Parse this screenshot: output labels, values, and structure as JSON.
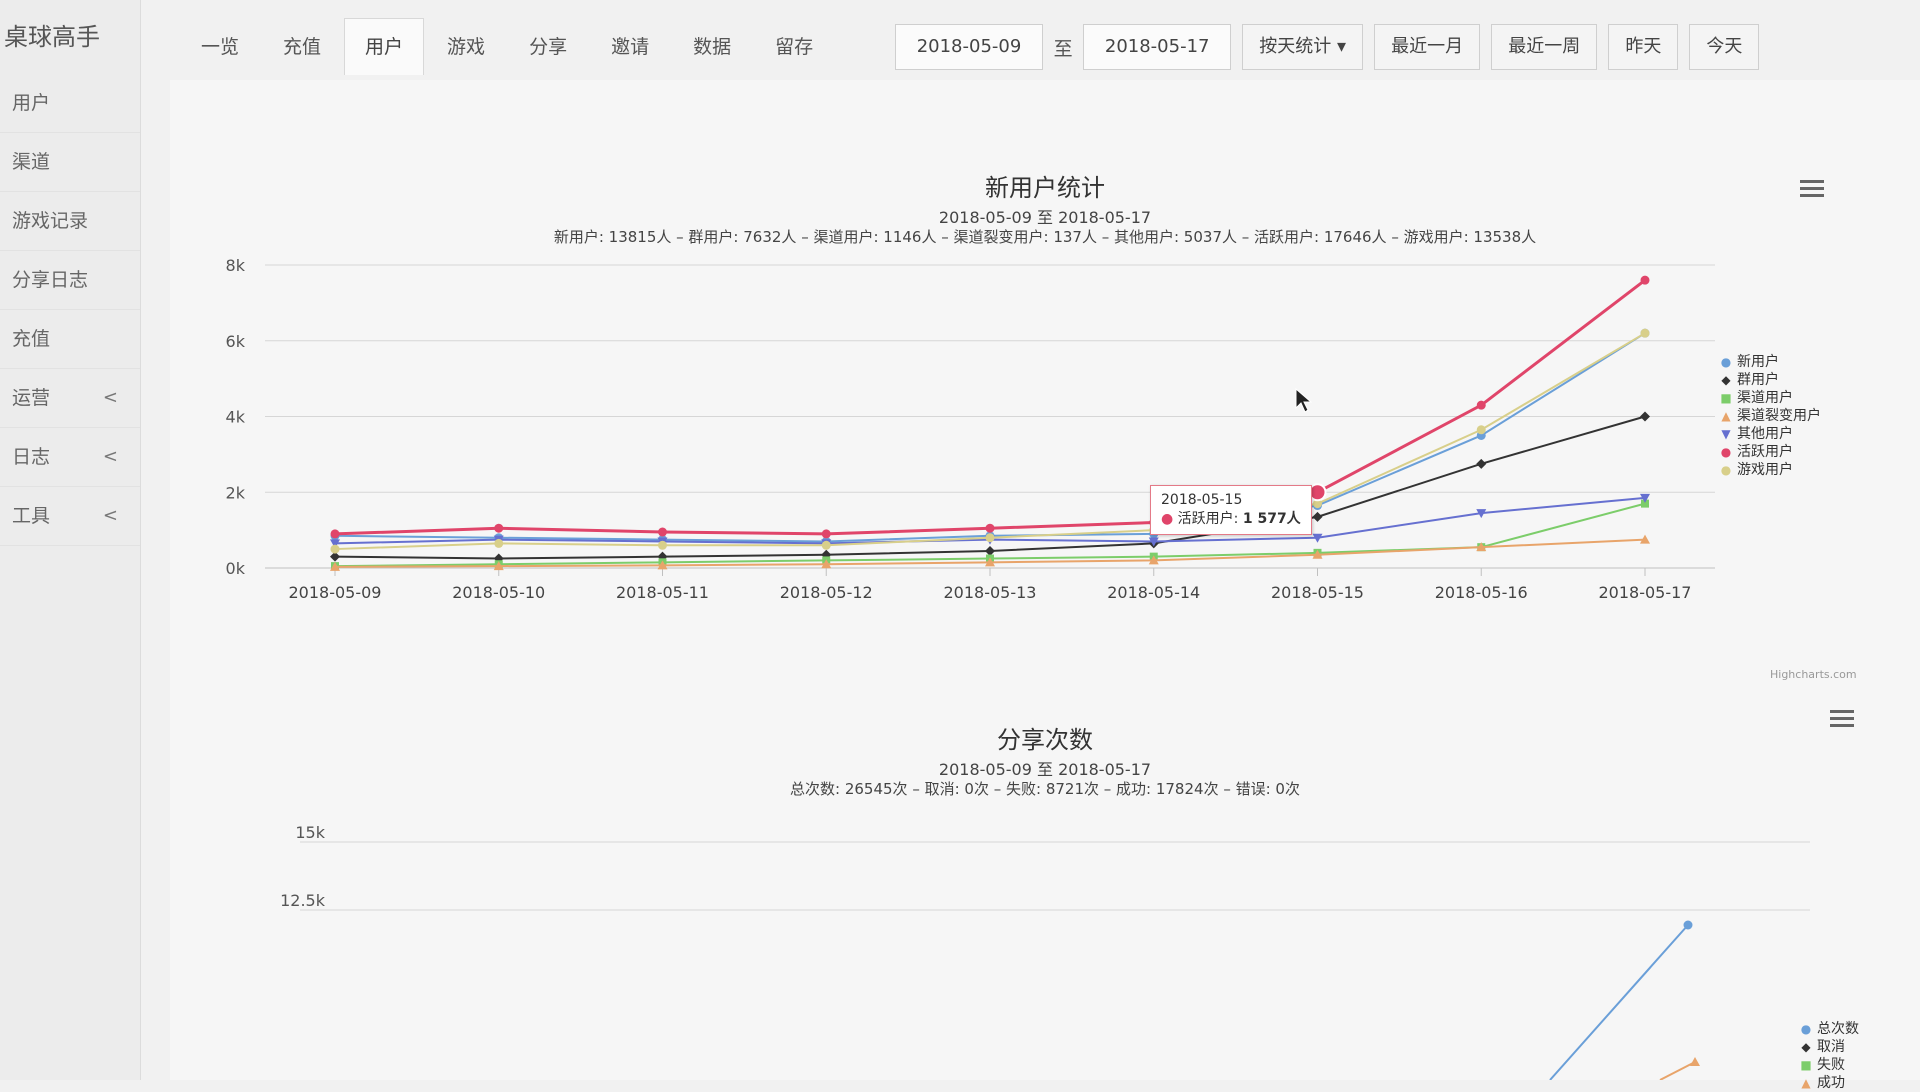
{
  "app": {
    "brand": "桌球高手"
  },
  "sidebar": {
    "items": [
      {
        "label": "用户",
        "caret": ""
      },
      {
        "label": "渠道",
        "caret": ""
      },
      {
        "label": "游戏记录",
        "caret": ""
      },
      {
        "label": "分享日志",
        "caret": ""
      },
      {
        "label": "充值",
        "caret": ""
      },
      {
        "label": "运营",
        "caret": "<"
      },
      {
        "label": "日志",
        "caret": "<"
      },
      {
        "label": "工具",
        "caret": "<"
      }
    ]
  },
  "tabs": [
    {
      "label": "一览",
      "active": false
    },
    {
      "label": "充值",
      "active": false
    },
    {
      "label": "用户",
      "active": true
    },
    {
      "label": "游戏",
      "active": false
    },
    {
      "label": "分享",
      "active": false
    },
    {
      "label": "邀请",
      "active": false
    },
    {
      "label": "数据",
      "active": false
    },
    {
      "label": "留存",
      "active": false
    }
  ],
  "filter": {
    "start_date": "2018-05-09",
    "to_label": "至",
    "end_date": "2018-05-17",
    "group_by": "按天统计 ▾",
    "btn_last_month": "最近一月",
    "btn_last_week": "最近一周",
    "btn_yesterday": "昨天",
    "btn_today": "今天"
  },
  "chart1": {
    "title": "新用户统计",
    "subtitle": "2018-05-09 至 2018-05-17",
    "summary": "新用户: 13815人 – 群用户: 7632人 – 渠道用户: 1146人 – 渠道裂变用户: 137人 – 其他用户: 5037人 – 活跃用户: 17646人 – 游戏用户: 13538人",
    "tooltip": {
      "date": "2018-05-15",
      "series": "活跃用户",
      "value": "1 577人"
    },
    "credit": "Highcharts.com"
  },
  "chart2": {
    "title": "分享次数",
    "subtitle": "2018-05-09 至 2018-05-17",
    "summary": "总次数: 26545次 – 取消: 0次 – 失败: 8721次 – 成功: 17824次 – 错误: 0次"
  },
  "chart_data": [
    {
      "type": "line",
      "title": "新用户统计",
      "subtitle": "2018-05-09 至 2018-05-17",
      "categories": [
        "2018-05-09",
        "2018-05-10",
        "2018-05-11",
        "2018-05-12",
        "2018-05-13",
        "2018-05-14",
        "2018-05-15",
        "2018-05-16",
        "2018-05-17"
      ],
      "ylim": [
        0,
        8000
      ],
      "yticks": [
        "0k",
        "2k",
        "4k",
        "6k",
        "8k"
      ],
      "legend_position": "right",
      "grid": true,
      "series": [
        {
          "name": "新用户",
          "color": "#6a9fd8",
          "marker": "circle",
          "values": [
            850,
            800,
            750,
            700,
            850,
            900,
            1650,
            3500,
            6200
          ]
        },
        {
          "name": "群用户",
          "color": "#333333",
          "marker": "diamond",
          "values": [
            300,
            250,
            300,
            350,
            450,
            650,
            1350,
            2750,
            4000
          ]
        },
        {
          "name": "渠道用户",
          "color": "#7ccd6a",
          "marker": "square",
          "values": [
            50,
            100,
            150,
            200,
            250,
            300,
            400,
            550,
            1700
          ]
        },
        {
          "name": "渠道裂变用户",
          "color": "#e8a46a",
          "marker": "triangle",
          "values": [
            30,
            50,
            70,
            100,
            150,
            200,
            350,
            550,
            750
          ]
        },
        {
          "name": "其他用户",
          "color": "#6670d0",
          "marker": "triangle-down",
          "values": [
            650,
            750,
            700,
            650,
            750,
            700,
            800,
            1450,
            1850
          ]
        },
        {
          "name": "活跃用户",
          "color": "#e0456a",
          "marker": "circle",
          "values": [
            900,
            1050,
            950,
            900,
            1050,
            1200,
            2000,
            4300,
            7600
          ]
        },
        {
          "name": "游戏用户",
          "color": "#d8cf8a",
          "marker": "circle",
          "values": [
            500,
            650,
            600,
            600,
            800,
            1000,
            1700,
            3650,
            6200
          ]
        }
      ]
    },
    {
      "type": "line",
      "title": "分享次数",
      "subtitle": "2018-05-09 至 2018-05-17",
      "yticks": [
        "12.5k",
        "15k"
      ],
      "legend": [
        "总次数",
        "取消",
        "失败",
        "成功"
      ],
      "legend_position": "right",
      "series_colors": [
        "#6a9fd8",
        "#333333",
        "#7ccd6a",
        "#e8a46a"
      ]
    }
  ]
}
